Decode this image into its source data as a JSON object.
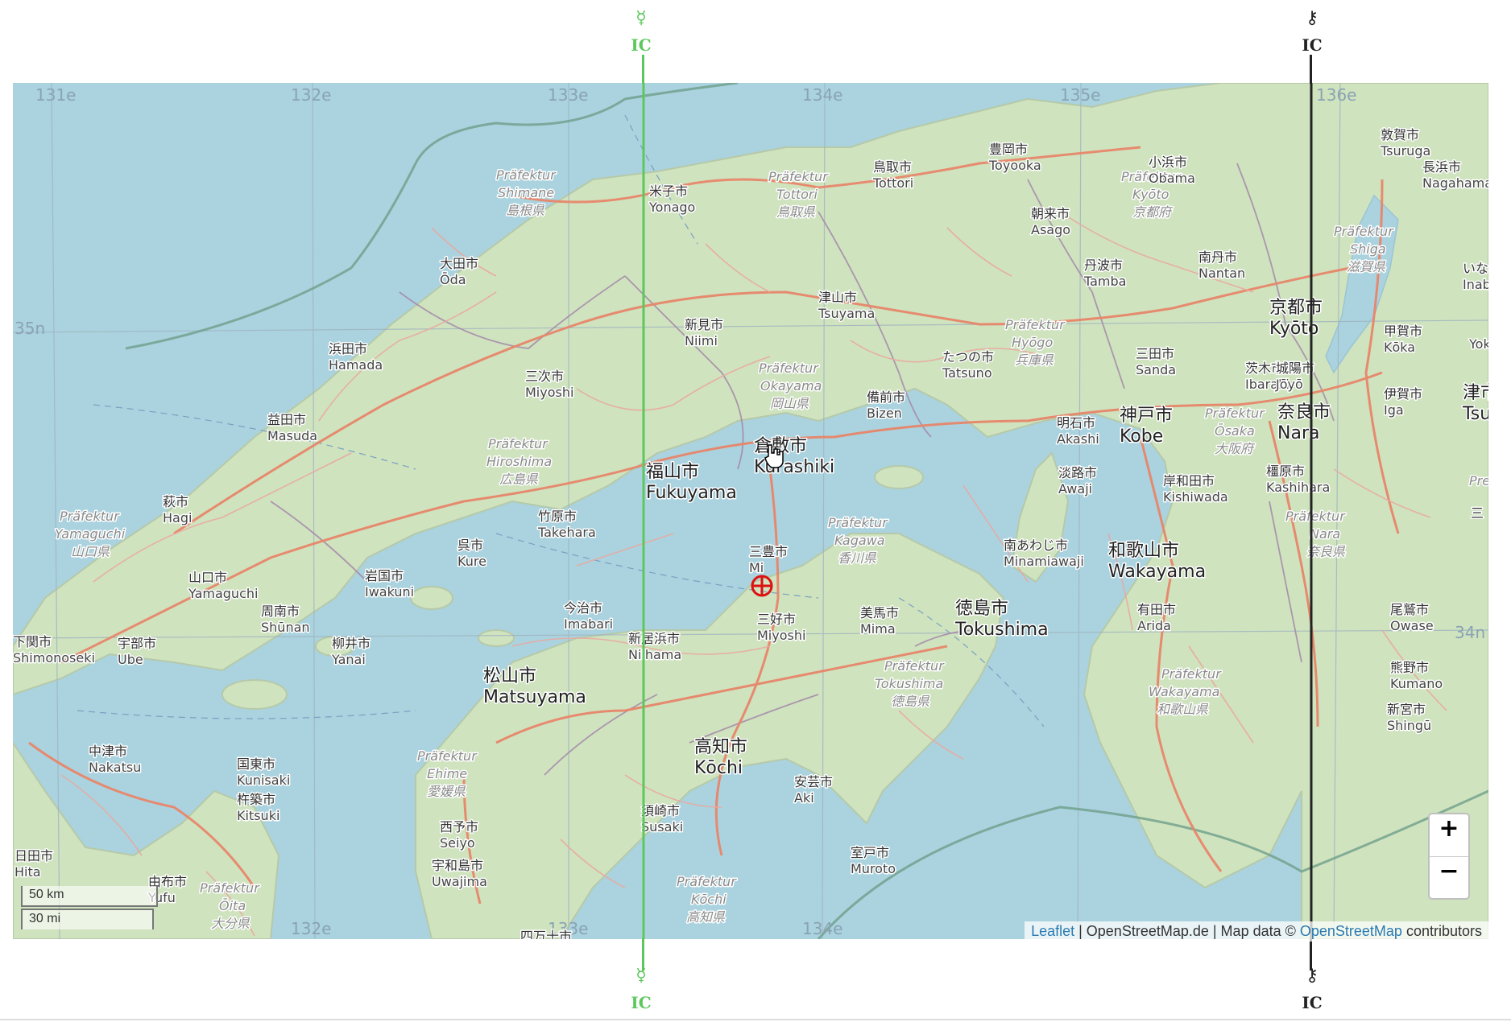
{
  "map": {
    "grid_labels": {
      "lon_top": [
        "131e",
        "132e",
        "133e",
        "134e",
        "135e",
        "136e"
      ],
      "lon_bottom": [
        "132e",
        "133e",
        "134e"
      ],
      "lat": [
        "35n",
        "34n"
      ]
    },
    "cities": [
      {
        "jp": "米子市",
        "lat": "Yonago"
      },
      {
        "jp": "鳥取市",
        "lat": "Tottori"
      },
      {
        "jp": "豊岡市",
        "lat": "Toyooka"
      },
      {
        "jp": "小浜市",
        "lat": "Obama"
      },
      {
        "jp": "敦賀市",
        "lat": "Tsuruga"
      },
      {
        "jp": "長浜市",
        "lat": "Nagahama"
      },
      {
        "jp": "朝来市",
        "lat": "Asago"
      },
      {
        "jp": "大田市",
        "lat": "Ōda"
      },
      {
        "jp": "津山市",
        "lat": "Tsuyama"
      },
      {
        "jp": "丹波市",
        "lat": "Tamba"
      },
      {
        "jp": "南丹市",
        "lat": "Nantan"
      },
      {
        "jp": "いなべ市",
        "lat": "Inabe"
      },
      {
        "jp": "新見市",
        "lat": "Niimi"
      },
      {
        "jp": "浜田市",
        "lat": "Hamada"
      },
      {
        "jp": "三次市",
        "lat": "Miyoshi"
      },
      {
        "jp": "たつの市",
        "lat": "Tatsuno"
      },
      {
        "jp": "三田市",
        "lat": "Sanda"
      },
      {
        "jp": "茨木市",
        "lat": "Ibaraki"
      },
      {
        "jp": "城陽市",
        "lat": "Jōyō"
      },
      {
        "jp": "甲賀市",
        "lat": "Kōka"
      },
      {
        "jp": "伊賀市",
        "lat": "Iga"
      },
      {
        "jp": "備前市",
        "lat": "Bizen"
      },
      {
        "jp": "益田市",
        "lat": "Masuda"
      },
      {
        "jp": "明石市",
        "lat": "Akashi"
      },
      {
        "jp": "淡路市",
        "lat": "Awaji"
      },
      {
        "jp": "岸和田市",
        "lat": "Kishiwada"
      },
      {
        "jp": "橿原市",
        "lat": "Kashihara"
      },
      {
        "jp": "萩市",
        "lat": "Hagi"
      },
      {
        "jp": "竹原市",
        "lat": "Takehara"
      },
      {
        "jp": "三豊市",
        "lat": "Mi"
      },
      {
        "jp": "南あわじ市",
        "lat": "Minamiawaji"
      },
      {
        "jp": "呉市",
        "lat": "Kure"
      },
      {
        "jp": "山口市",
        "lat": "Yamaguchi"
      },
      {
        "jp": "岩国市",
        "lat": "Iwakuni"
      },
      {
        "jp": "今治市",
        "lat": "Imabari"
      },
      {
        "jp": "三好市",
        "lat": "Miyoshi"
      },
      {
        "jp": "美馬市",
        "lat": "Mima"
      },
      {
        "jp": "有田市",
        "lat": "Arida"
      },
      {
        "jp": "尾鷲市",
        "lat": "Owase"
      },
      {
        "jp": "周南市",
        "lat": "Shūnan"
      },
      {
        "jp": "下関市",
        "lat": "Shimonoseki"
      },
      {
        "jp": "宇部市",
        "lat": "Ube"
      },
      {
        "jp": "柳井市",
        "lat": "Yanai"
      },
      {
        "jp": "新居浜市",
        "lat": "Niihama"
      },
      {
        "jp": "熊野市",
        "lat": "Kumano"
      },
      {
        "jp": "新宮市",
        "lat": "Shingū"
      },
      {
        "jp": "中津市",
        "lat": "Nakatsu"
      },
      {
        "jp": "国東市",
        "lat": "Kunisaki"
      },
      {
        "jp": "安芸市",
        "lat": "Aki"
      },
      {
        "jp": "杵築市",
        "lat": "Kitsuki"
      },
      {
        "jp": "須崎市",
        "lat": "Susaki"
      },
      {
        "jp": "西予市",
        "lat": "Seiyo"
      },
      {
        "jp": "日田市",
        "lat": "Hita"
      },
      {
        "jp": "室戸市",
        "lat": "Muroto"
      },
      {
        "jp": "宇和島市",
        "lat": "Uwajima"
      },
      {
        "jp": "由布市",
        "lat": "Yufu"
      }
    ],
    "big_cities": [
      {
        "jp": "京都市",
        "lat": "Kyōto"
      },
      {
        "jp": "倉敷市",
        "lat": "Kurashiki"
      },
      {
        "jp": "福山市",
        "lat": "Fukuyama"
      },
      {
        "jp": "神戸市",
        "lat": "Kobe"
      },
      {
        "jp": "奈良市",
        "lat": "Nara"
      },
      {
        "jp": "和歌山市",
        "lat": "Wakayama"
      },
      {
        "jp": "徳島市",
        "lat": "Tokushima"
      },
      {
        "jp": "松山市",
        "lat": "Matsuyama"
      },
      {
        "jp": "高知市",
        "lat": "Kōchi"
      },
      {
        "jp": "津市",
        "lat": "Tsu"
      }
    ],
    "prefectures": [
      {
        "de": "Präfektur",
        "name": "Shimane",
        "jp": "島根県"
      },
      {
        "de": "Präfektur",
        "name": "Tottori",
        "jp": "鳥取県"
      },
      {
        "de": "Präfektur",
        "name": "Kyōto",
        "jp": "京都府"
      },
      {
        "de": "Präfektur",
        "name": "Shiga",
        "jp": "滋賀県"
      },
      {
        "de": "Präfektur",
        "name": "Hyōgo",
        "jp": "兵庫県"
      },
      {
        "de": "Präfektur",
        "name": "Okayama",
        "jp": "岡山県"
      },
      {
        "de": "Präfektur",
        "name": "Hiroshima",
        "jp": "広島県"
      },
      {
        "de": "Präfektur",
        "name": "Ōsaka",
        "jp": "大阪府"
      },
      {
        "de": "Präfektur",
        "name": "Yamaguchi",
        "jp": "山口県"
      },
      {
        "de": "Präfektur",
        "name": "Kagawa",
        "jp": "香川県"
      },
      {
        "de": "Präfektur",
        "name": "Nara",
        "jp": "奈良県"
      },
      {
        "de": "Präfektur",
        "name": "Tokushima",
        "jp": "徳島県"
      },
      {
        "de": "Präfektur",
        "name": "Wakayama",
        "jp": "和歌山県"
      },
      {
        "de": "Präfektur",
        "name": "Ehime",
        "jp": "愛媛県"
      },
      {
        "de": "Präfektur",
        "name": "Kōchi",
        "jp": "高知県"
      },
      {
        "de": "Präfektur",
        "name": "Ōita",
        "jp": "大分県"
      }
    ],
    "partial_labels": [
      "三",
      "Yok",
      "Pre",
      "四万十市",
      "yu"
    ]
  },
  "overlay_lines": {
    "left": {
      "glyph": "☿",
      "label": "IC",
      "color": "#5cc85c"
    },
    "right": {
      "glyph": "⚷",
      "label": "IC",
      "color": "#222222"
    }
  },
  "controls": {
    "zoom_in": "+",
    "zoom_out": "−"
  },
  "scale": {
    "km": "50 km",
    "mi": "30 mi"
  },
  "attribution": {
    "leaflet": "Leaflet",
    "sep1": " | OpenStreetMap.de | Map data © ",
    "osm": "OpenStreetMap",
    "suffix": " contributors"
  },
  "colors": {
    "water": "#aad3df",
    "land": "#cfe3bf",
    "road_major": "#e8866a",
    "road_minor": "#e9a8a0",
    "boundary": "#9c7fa0"
  }
}
